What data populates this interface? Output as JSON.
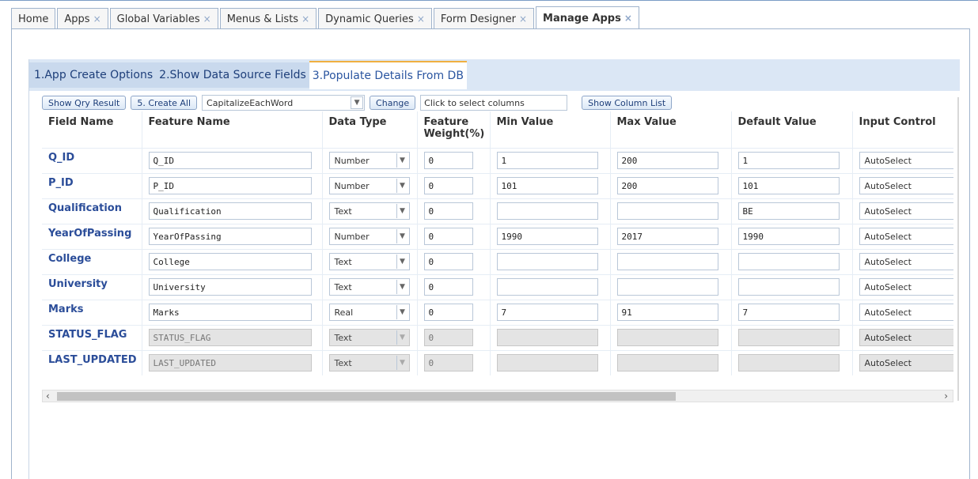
{
  "tabs": [
    {
      "label": "Home",
      "closable": false
    },
    {
      "label": "Apps",
      "closable": true
    },
    {
      "label": "Global Variables",
      "closable": true
    },
    {
      "label": "Menus & Lists",
      "closable": true
    },
    {
      "label": "Dynamic Queries",
      "closable": true
    },
    {
      "label": "Form Designer",
      "closable": true
    },
    {
      "label": "Manage Apps",
      "closable": true,
      "active": true
    }
  ],
  "close_glyph": "×",
  "wizard": {
    "step1": "1.App Create Options",
    "step2": "2.Show Data Source Fields",
    "step3": "3.Populate Details From DB"
  },
  "toolbar": {
    "show_qry_result": "Show Qry Result",
    "create_all": "5. Create All",
    "case_option": "CapitalizeEachWord",
    "change": "Change",
    "select_columns_placeholder": "Click to select columns",
    "show_column_list": "Show Column List"
  },
  "grid": {
    "headers": {
      "field_name": "Field Name",
      "feature_name": "Feature Name",
      "data_type": "Data Type",
      "feature_weight_1": "Feature",
      "feature_weight_2": "Weight(%)",
      "min_value": "Min Value",
      "max_value": "Max Value",
      "default_value": "Default Value",
      "input_control": "Input Control"
    },
    "rows": [
      {
        "field": "Q_ID",
        "feature": "Q_ID",
        "type": "Number",
        "weight": "0",
        "min": "1",
        "max": "200",
        "default": "1",
        "control": "AutoSelect",
        "disabled": false
      },
      {
        "field": "P_ID",
        "feature": "P_ID",
        "type": "Number",
        "weight": "0",
        "min": "101",
        "max": "200",
        "default": "101",
        "control": "AutoSelect",
        "disabled": false
      },
      {
        "field": "Qualification",
        "feature": "Qualification",
        "type": "Text",
        "weight": "0",
        "min": "",
        "max": "",
        "default": "BE",
        "control": "AutoSelect",
        "disabled": false
      },
      {
        "field": "YearOfPassing",
        "feature": "YearOfPassing",
        "type": "Number",
        "weight": "0",
        "min": "1990",
        "max": "2017",
        "default": "1990",
        "control": "AutoSelect",
        "disabled": false
      },
      {
        "field": "College",
        "feature": "College",
        "type": "Text",
        "weight": "0",
        "min": "",
        "max": "",
        "default": "",
        "control": "AutoSelect",
        "disabled": false
      },
      {
        "field": "University",
        "feature": "University",
        "type": "Text",
        "weight": "0",
        "min": "",
        "max": "",
        "default": "",
        "control": "AutoSelect",
        "disabled": false
      },
      {
        "field": "Marks",
        "feature": "Marks",
        "type": "Real",
        "weight": "0",
        "min": "7",
        "max": "91",
        "default": "7",
        "control": "AutoSelect",
        "disabled": false
      },
      {
        "field": "STATUS_FLAG",
        "feature": "STATUS_FLAG",
        "type": "Text",
        "weight": "0",
        "min": "",
        "max": "",
        "default": "",
        "control": "AutoSelect",
        "disabled": true
      },
      {
        "field": "LAST_UPDATED",
        "feature": "LAST_UPDATED",
        "type": "Text",
        "weight": "0",
        "min": "",
        "max": "",
        "default": "",
        "control": "AutoSelect",
        "disabled": true
      }
    ]
  },
  "scrollbar": {
    "left_arrow": "‹",
    "right_arrow": "›"
  },
  "colors": {
    "accent": "#2b4d99",
    "tab_border": "#9fb3cc",
    "wizard_bg": "#dbe7f5"
  }
}
